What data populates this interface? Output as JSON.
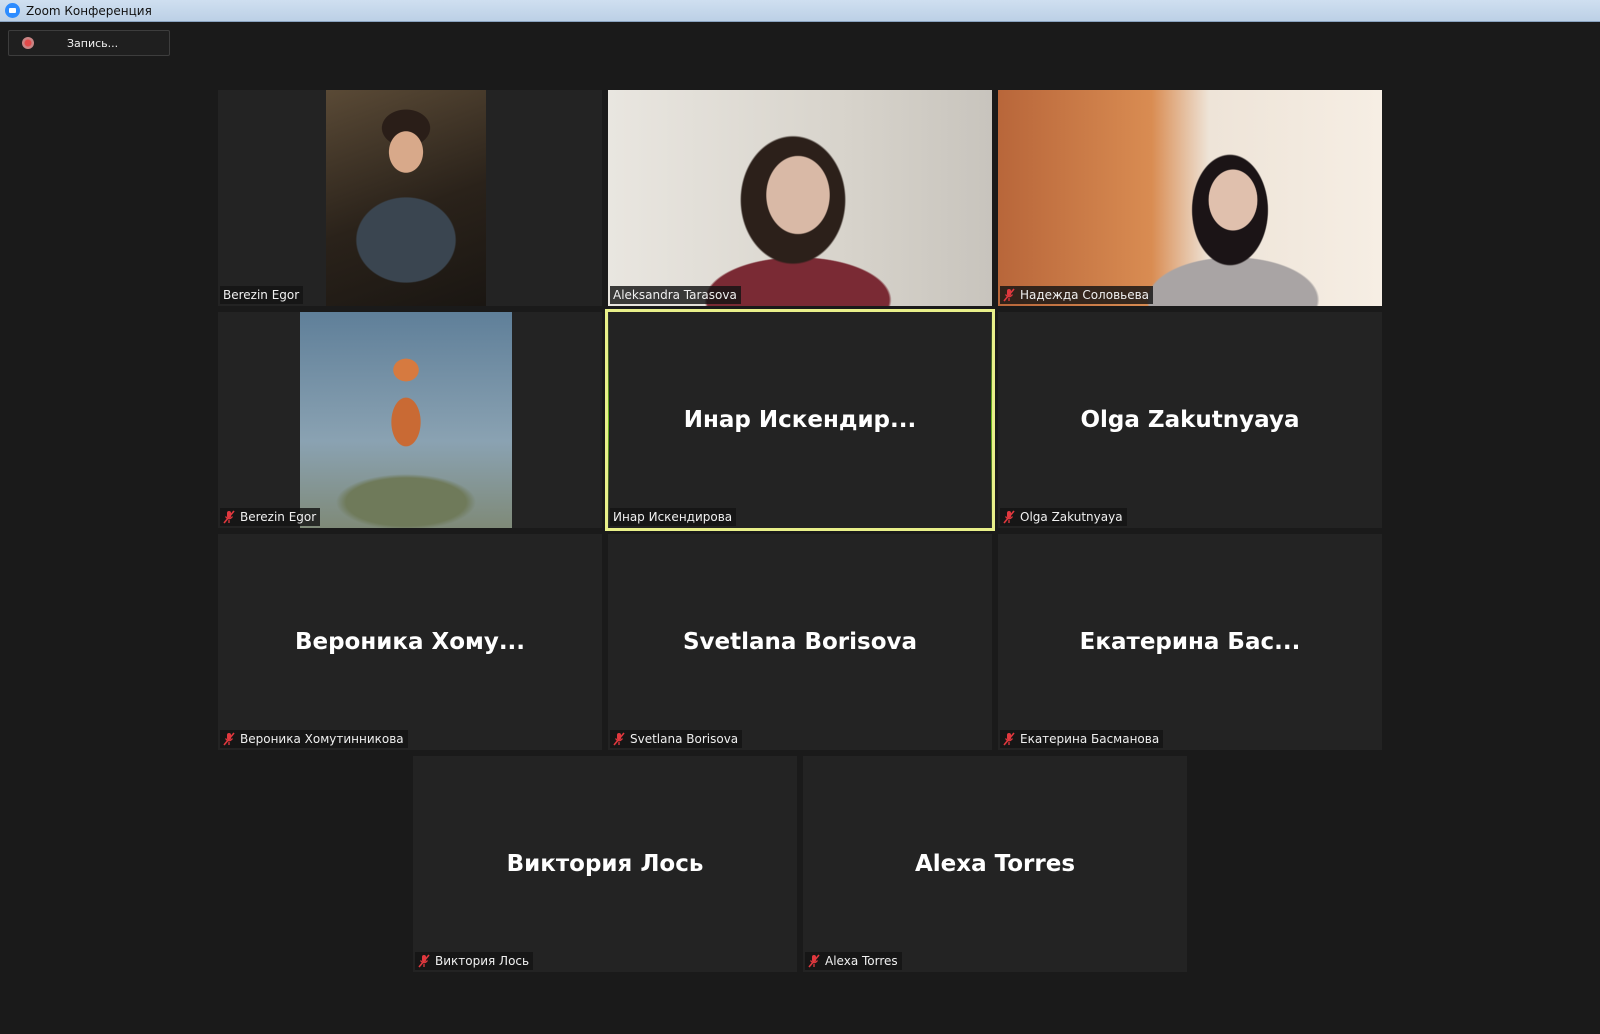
{
  "window": {
    "title": "Zoom Конференция"
  },
  "recording": {
    "label": "Запись..."
  },
  "participants": [
    {
      "name": "Berezin Egor",
      "video": true,
      "muted": false
    },
    {
      "name": "Aleksandra Tarasova",
      "video": true,
      "muted": false
    },
    {
      "name": "Надежда Соловьева",
      "video": true,
      "muted": true
    },
    {
      "name": "Berezin Egor",
      "video": true,
      "muted": true
    },
    {
      "name": "Инар Искендирова",
      "display": "Инар  Искендир...",
      "video": false,
      "muted": false,
      "active_speaker": true
    },
    {
      "name": "Olga Zakutnyaya",
      "display": "Olga Zakutnyaya",
      "video": false,
      "muted": true
    },
    {
      "name": "Вероника Хомутинникова",
      "display": "Вероника  Хому...",
      "video": false,
      "muted": true
    },
    {
      "name": "Svetlana Borisova",
      "display": "Svetlana Borisova",
      "video": false,
      "muted": true
    },
    {
      "name": "Екатерина Басманова",
      "display": "Екатерина  Бас...",
      "video": false,
      "muted": true
    },
    {
      "name": "Виктория Лось",
      "display": "Виктория Лось",
      "video": false,
      "muted": true
    },
    {
      "name": "Alexa Torres",
      "display": "Alexa Torres",
      "video": false,
      "muted": true
    }
  ],
  "colors": {
    "active_speaker_border": "#e9f08a",
    "muted_icon": "#e0383e",
    "tile_bg": "#232323"
  }
}
